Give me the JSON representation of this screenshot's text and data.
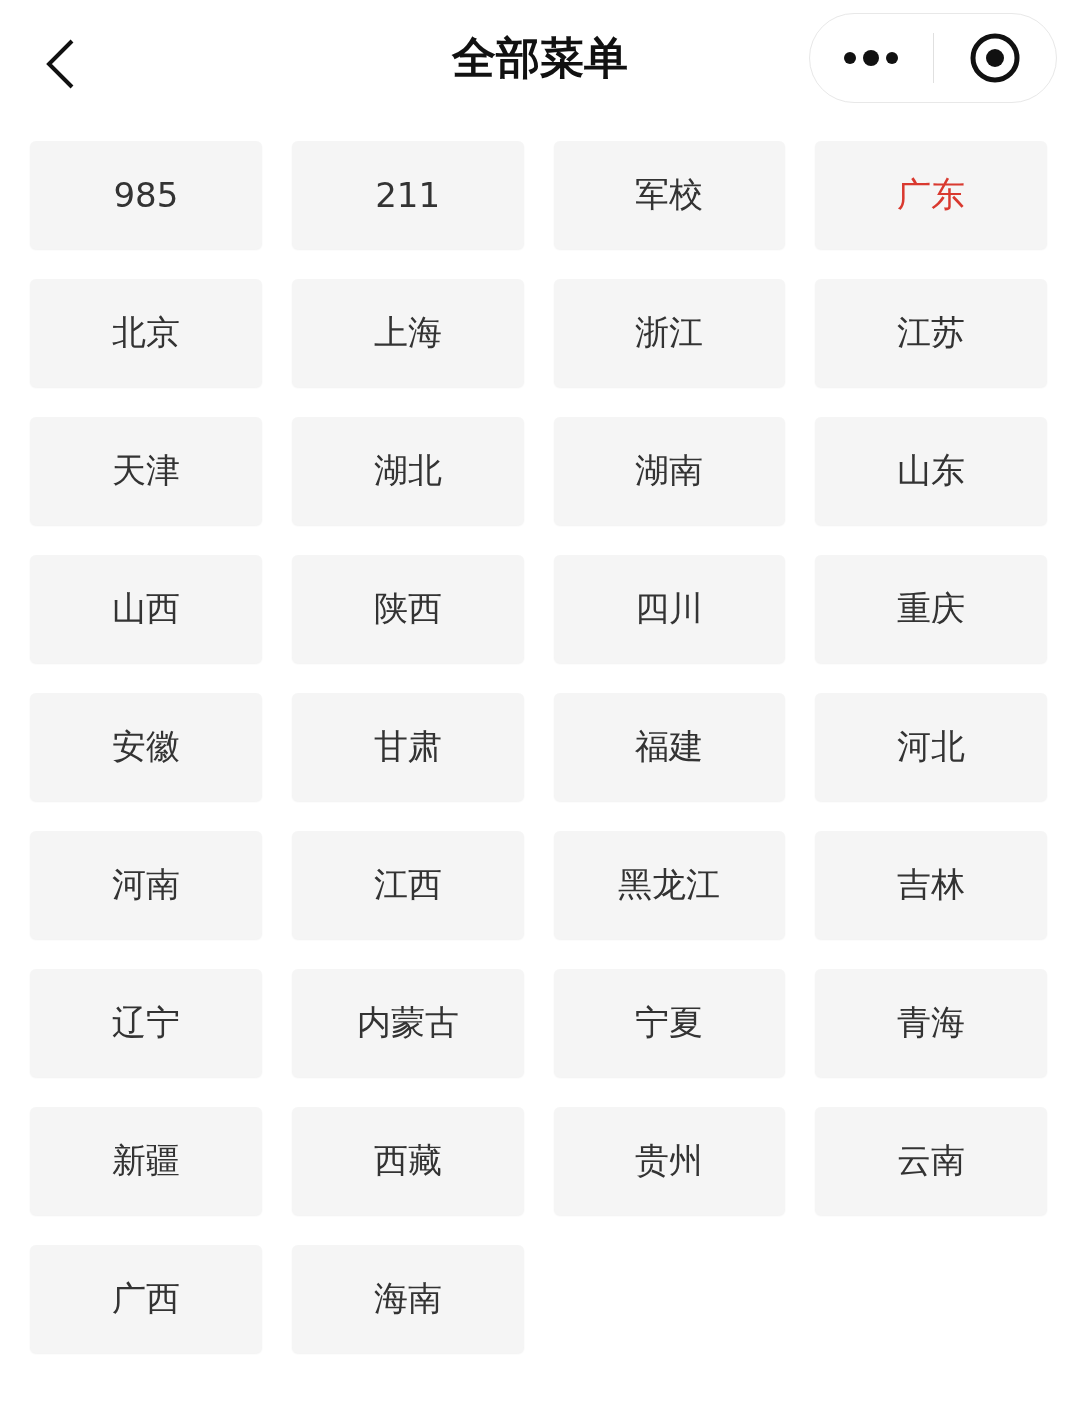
{
  "header": {
    "title": "全部菜单"
  },
  "menu_items": [
    {
      "label": "985",
      "selected": false
    },
    {
      "label": "211",
      "selected": false
    },
    {
      "label": "军校",
      "selected": false
    },
    {
      "label": "广东",
      "selected": true
    },
    {
      "label": "北京",
      "selected": false
    },
    {
      "label": "上海",
      "selected": false
    },
    {
      "label": "浙江",
      "selected": false
    },
    {
      "label": "江苏",
      "selected": false
    },
    {
      "label": "天津",
      "selected": false
    },
    {
      "label": "湖北",
      "selected": false
    },
    {
      "label": "湖南",
      "selected": false
    },
    {
      "label": "山东",
      "selected": false
    },
    {
      "label": "山西",
      "selected": false
    },
    {
      "label": "陕西",
      "selected": false
    },
    {
      "label": "四川",
      "selected": false
    },
    {
      "label": "重庆",
      "selected": false
    },
    {
      "label": "安徽",
      "selected": false
    },
    {
      "label": "甘肃",
      "selected": false
    },
    {
      "label": "福建",
      "selected": false
    },
    {
      "label": "河北",
      "selected": false
    },
    {
      "label": "河南",
      "selected": false
    },
    {
      "label": "江西",
      "selected": false
    },
    {
      "label": "黑龙江",
      "selected": false
    },
    {
      "label": "吉林",
      "selected": false
    },
    {
      "label": "辽宁",
      "selected": false
    },
    {
      "label": "内蒙古",
      "selected": false
    },
    {
      "label": "宁夏",
      "selected": false
    },
    {
      "label": "青海",
      "selected": false
    },
    {
      "label": "新疆",
      "selected": false
    },
    {
      "label": "西藏",
      "selected": false
    },
    {
      "label": "贵州",
      "selected": false
    },
    {
      "label": "云南",
      "selected": false
    },
    {
      "label": "广西",
      "selected": false
    },
    {
      "label": "海南",
      "selected": false
    }
  ]
}
